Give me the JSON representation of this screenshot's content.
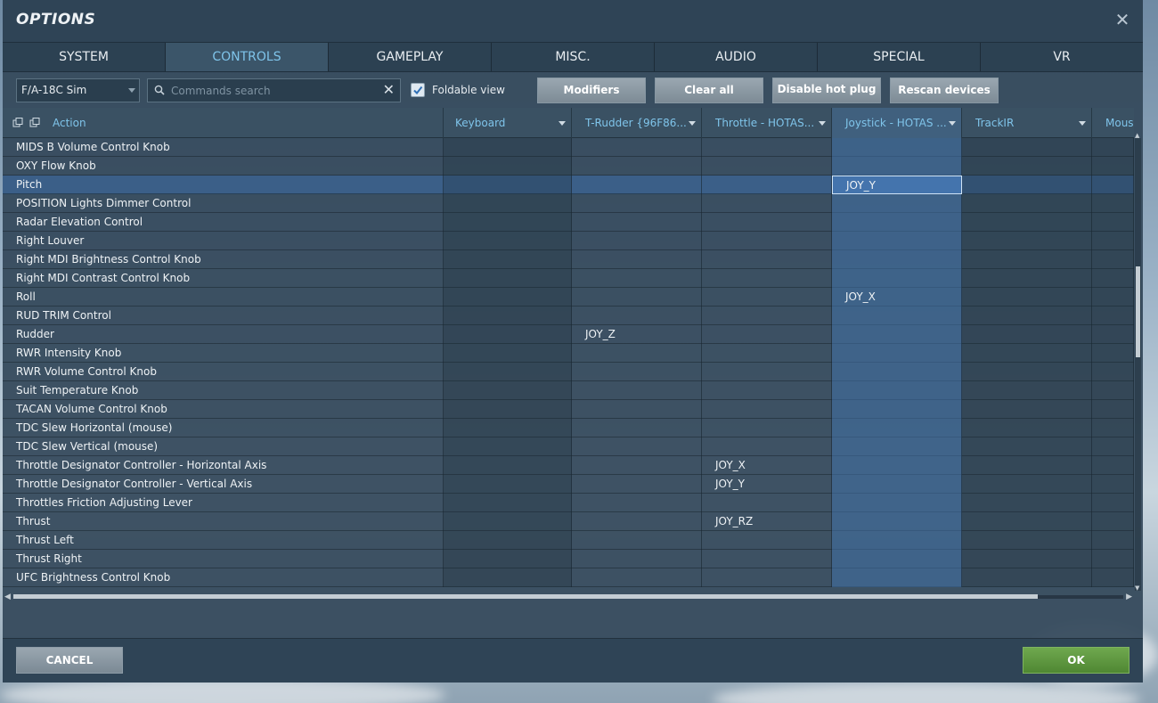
{
  "window": {
    "title": "OPTIONS"
  },
  "tabs": [
    {
      "label": "SYSTEM",
      "active": false
    },
    {
      "label": "CONTROLS",
      "active": true
    },
    {
      "label": "GAMEPLAY",
      "active": false
    },
    {
      "label": "MISC.",
      "active": false
    },
    {
      "label": "AUDIO",
      "active": false
    },
    {
      "label": "SPECIAL",
      "active": false
    },
    {
      "label": "VR",
      "active": false
    }
  ],
  "toolbar": {
    "aircraft_select": "F/A-18C Sim",
    "search_placeholder": "Commands search",
    "search_value": "",
    "foldable_view_label": "Foldable view",
    "foldable_view_checked": true,
    "modifiers_label": "Modifiers",
    "clear_all_label": "Clear all",
    "disable_hot_plug_label": "Disable hot plug",
    "rescan_devices_label": "Rescan devices"
  },
  "table": {
    "columns": [
      "Action",
      "Keyboard",
      "T-Rudder {96F86...",
      "Throttle - HOTAS...",
      "Joystick - HOTAS ...",
      "TrackIR",
      "Mous"
    ],
    "rows": [
      {
        "action": "MIDS B Volume Control Knob",
        "keyboard": "",
        "trudder": "",
        "throttle": "",
        "joystick": "",
        "trackir": "",
        "mouse": ""
      },
      {
        "action": "OXY Flow Knob",
        "keyboard": "",
        "trudder": "",
        "throttle": "",
        "joystick": "",
        "trackir": "",
        "mouse": ""
      },
      {
        "action": "Pitch",
        "keyboard": "",
        "trudder": "",
        "throttle": "",
        "joystick": "JOY_Y",
        "trackir": "",
        "mouse": "",
        "selected": true
      },
      {
        "action": "POSITION Lights Dimmer Control",
        "keyboard": "",
        "trudder": "",
        "throttle": "",
        "joystick": "",
        "trackir": "",
        "mouse": ""
      },
      {
        "action": "Radar Elevation Control",
        "keyboard": "",
        "trudder": "",
        "throttle": "",
        "joystick": "",
        "trackir": "",
        "mouse": ""
      },
      {
        "action": "Right Louver",
        "keyboard": "",
        "trudder": "",
        "throttle": "",
        "joystick": "",
        "trackir": "",
        "mouse": ""
      },
      {
        "action": "Right MDI Brightness Control Knob",
        "keyboard": "",
        "trudder": "",
        "throttle": "",
        "joystick": "",
        "trackir": "",
        "mouse": ""
      },
      {
        "action": "Right MDI Contrast Control Knob",
        "keyboard": "",
        "trudder": "",
        "throttle": "",
        "joystick": "",
        "trackir": "",
        "mouse": ""
      },
      {
        "action": "Roll",
        "keyboard": "",
        "trudder": "",
        "throttle": "",
        "joystick": "JOY_X",
        "trackir": "",
        "mouse": ""
      },
      {
        "action": "RUD TRIM Control",
        "keyboard": "",
        "trudder": "",
        "throttle": "",
        "joystick": "",
        "trackir": "",
        "mouse": ""
      },
      {
        "action": "Rudder",
        "keyboard": "",
        "trudder": "JOY_Z",
        "throttle": "",
        "joystick": "",
        "trackir": "",
        "mouse": ""
      },
      {
        "action": "RWR Intensity Knob",
        "keyboard": "",
        "trudder": "",
        "throttle": "",
        "joystick": "",
        "trackir": "",
        "mouse": ""
      },
      {
        "action": "RWR Volume Control Knob",
        "keyboard": "",
        "trudder": "",
        "throttle": "",
        "joystick": "",
        "trackir": "",
        "mouse": ""
      },
      {
        "action": "Suit Temperature Knob",
        "keyboard": "",
        "trudder": "",
        "throttle": "",
        "joystick": "",
        "trackir": "",
        "mouse": ""
      },
      {
        "action": "TACAN Volume Control Knob",
        "keyboard": "",
        "trudder": "",
        "throttle": "",
        "joystick": "",
        "trackir": "",
        "mouse": ""
      },
      {
        "action": "TDC Slew Horizontal (mouse)",
        "keyboard": "",
        "trudder": "",
        "throttle": "",
        "joystick": "",
        "trackir": "",
        "mouse": ""
      },
      {
        "action": "TDC Slew Vertical (mouse)",
        "keyboard": "",
        "trudder": "",
        "throttle": "",
        "joystick": "",
        "trackir": "",
        "mouse": ""
      },
      {
        "action": "Throttle Designator Controller - Horizontal Axis",
        "keyboard": "",
        "trudder": "",
        "throttle": "JOY_X",
        "joystick": "",
        "trackir": "",
        "mouse": ""
      },
      {
        "action": "Throttle Designator Controller - Vertical Axis",
        "keyboard": "",
        "trudder": "",
        "throttle": "JOY_Y",
        "joystick": "",
        "trackir": "",
        "mouse": ""
      },
      {
        "action": "Throttles Friction Adjusting Lever",
        "keyboard": "",
        "trudder": "",
        "throttle": "",
        "joystick": "",
        "trackir": "",
        "mouse": ""
      },
      {
        "action": "Thrust",
        "keyboard": "",
        "trudder": "",
        "throttle": "JOY_RZ",
        "joystick": "",
        "trackir": "",
        "mouse": ""
      },
      {
        "action": "Thrust Left",
        "keyboard": "",
        "trudder": "",
        "throttle": "",
        "joystick": "",
        "trackir": "",
        "mouse": ""
      },
      {
        "action": "Thrust Right",
        "keyboard": "",
        "trudder": "",
        "throttle": "",
        "joystick": "",
        "trackir": "",
        "mouse": ""
      },
      {
        "action": "UFC Brightness Control Knob",
        "keyboard": "",
        "trudder": "",
        "throttle": "",
        "joystick": "",
        "trackir": "",
        "mouse": ""
      }
    ]
  },
  "footer": {
    "cancel_label": "CANCEL",
    "ok_label": "OK"
  },
  "colors": {
    "accent": "#7fc4ea",
    "ok_green": "#5a9a3c",
    "joystick_column": "#4272aa"
  }
}
